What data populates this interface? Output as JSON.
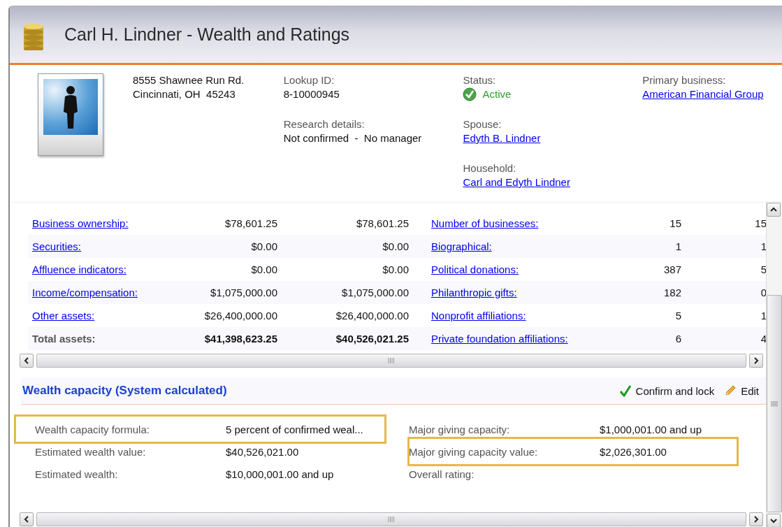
{
  "window": {
    "title": "Carl H. Lindner - Wealth and Ratings"
  },
  "profile": {
    "address": [
      "8555 Shawnee Run Rd.",
      "Cincinnati, OH  45243"
    ],
    "columns": [
      [
        {
          "label": "Lookup ID:",
          "value": "8-10000945",
          "kind": "text"
        },
        {
          "label": "Research details:",
          "value": "Not confirmed  -  No manager",
          "kind": "text"
        }
      ],
      [
        {
          "label": "Status:",
          "value": "Active",
          "kind": "status"
        },
        {
          "label": "Spouse:",
          "value": "Edyth B. Lindner",
          "kind": "link"
        },
        {
          "label": "Household:",
          "value": "Carl and Edyth Lindner",
          "kind": "link"
        }
      ],
      [
        {
          "label": "Primary business:",
          "value": "American Financial Group",
          "kind": "link"
        }
      ]
    ]
  },
  "assets": [
    {
      "label": "Business ownership:",
      "kind": "link",
      "values": [
        "$78,601.25",
        "$78,601.25"
      ]
    },
    {
      "label": "Securities:",
      "kind": "link",
      "values": [
        "$0.00",
        "$0.00"
      ]
    },
    {
      "label": "Affluence indicators:",
      "kind": "link",
      "values": [
        "$0.00",
        "$0.00"
      ]
    },
    {
      "label": "Income/compensation:",
      "kind": "link",
      "values": [
        "$1,075,000.00",
        "$1,075,000.00"
      ]
    },
    {
      "label": "Other assets:",
      "kind": "link",
      "values": [
        "$26,400,000.00",
        "$26,400,000.00"
      ]
    },
    {
      "label": "Total assets:",
      "kind": "total",
      "values": [
        "$41,398,623.25",
        "$40,526,021.25"
      ]
    }
  ],
  "activity": [
    {
      "label": "Number of businesses:",
      "values": [
        "15",
        "15"
      ]
    },
    {
      "label": "Biographical:",
      "values": [
        "1",
        "1"
      ]
    },
    {
      "label": "Political donations:",
      "values": [
        "387",
        "5"
      ]
    },
    {
      "label": "Philanthropic gifts:",
      "values": [
        "182",
        "0"
      ]
    },
    {
      "label": "Nonprofit affiliations:",
      "values": [
        "5",
        "1"
      ]
    },
    {
      "label": "Private foundation affiliations:",
      "values": [
        "6",
        "4"
      ]
    }
  ],
  "wealth_capacity": {
    "title": "Wealth capacity (System calculated)",
    "actions": [
      {
        "label": "Confirm and lock",
        "kind": "confirm"
      },
      {
        "label": "Edit",
        "kind": "edit"
      }
    ],
    "left_fields": [
      {
        "label": "Wealth capacity formula:",
        "value": "5 percent of confirmed weal...",
        "highlighted": true
      },
      {
        "label": "Estimated wealth value:",
        "value": "$40,526,021.00",
        "highlighted": false
      },
      {
        "label": "Estimated wealth:",
        "value": "$10,000,001.00 and up",
        "highlighted": false
      }
    ],
    "right_fields": [
      {
        "label": "Major giving capacity:",
        "value": "$1,000,001.00 and up",
        "highlighted": false
      },
      {
        "label": "Major giving capacity value:",
        "value": "$2,026,301.00",
        "highlighted": true
      },
      {
        "label": "Overall rating:",
        "highlighted": false
      }
    ]
  }
}
